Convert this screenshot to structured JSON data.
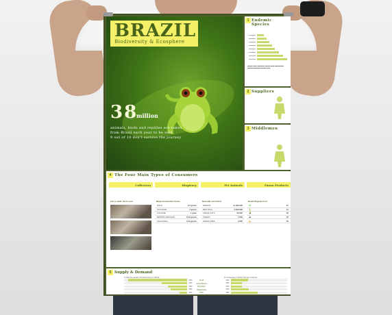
{
  "poster": {
    "title": "BRAZIL",
    "subtitle": "Biodiversity & Ecosphere",
    "stat_number": "38",
    "stat_unit": "million",
    "stat_line1": "animals, birds and reptiles are taken",
    "stat_line2": "from Brazil each year to be sold.",
    "stat_line3": "9 out of 10 don't survive the journey"
  },
  "sections": {
    "s1": {
      "num": "1",
      "title": "Endemic Species"
    },
    "s2": {
      "num": "2",
      "title": "Suppliers"
    },
    "s3": {
      "num": "3",
      "title": "Middlemen"
    },
    "s4": {
      "num": "4",
      "title": "The Four Main Types of Consumers"
    },
    "s5": {
      "num": "5",
      "title": "Supply & Demand"
    }
  },
  "consumers": [
    {
      "head": "Collectors",
      "sub": "Cut or stuff, but if soon",
      "rows": [
        {
          "label": "",
          "value": ""
        },
        {
          "label": "",
          "value": ""
        }
      ]
    },
    {
      "head": "Biopiracy",
      "sub": "Basel Convention Crisis",
      "rows": [
        {
          "label": "GOLD",
          "value": "3-5 grams"
        },
        {
          "label": "PLATINUM",
          "value": "2 grams"
        },
        {
          "label": "COCAINE",
          "value": "1 gram"
        },
        {
          "label": "BROWN CAPUCHIN",
          "value": "8-10 grams"
        },
        {
          "label": "ANACONDA",
          "value": "9-10 grams"
        }
      ]
    },
    {
      "head": "Pet Animals",
      "sub": "Nest will out Ocelot",
      "rows": [
        {
          "label": "PARROT",
          "value": "11,000,000"
        },
        {
          "label": "RED TAILS",
          "value": "6,000,000"
        },
        {
          "label": "LARGE CATS",
          "value": "25,000"
        },
        {
          "label": "TIGERS",
          "value": "7,500"
        },
        {
          "label": "GREAT APES",
          "value": "3,500"
        }
      ]
    },
    {
      "head": "Fauna Products",
      "sub": "Brazil Organic Cost",
      "rows": [
        {
          "label": "",
          "value": "15"
        },
        {
          "label": "",
          "value": "12"
        },
        {
          "label": "",
          "value": "30"
        },
        {
          "label": "",
          "value": "50"
        },
        {
          "label": "",
          "value": "30"
        }
      ]
    }
  ],
  "supply": {
    "left_caption": "% that the world's demand rising in World",
    "right_caption": "% of species in World that are endured",
    "rows": [
      {
        "label": "Gold",
        "left": "93%",
        "right": "30%"
      },
      {
        "label": "Amphibian",
        "left": "40%",
        "right": "20%"
      },
      {
        "label": "Reptiles",
        "left": "30%",
        "right": "19%"
      },
      {
        "label": "Mammals",
        "left": "26%",
        "right": "32%"
      },
      {
        "label": "Fish",
        "left": "12%",
        "right": "48%"
      }
    ]
  },
  "colors": {
    "olive": "#4d5f2b",
    "accent": "#f4f067",
    "bar": "#c6d96a",
    "text_green": "#48641b"
  }
}
